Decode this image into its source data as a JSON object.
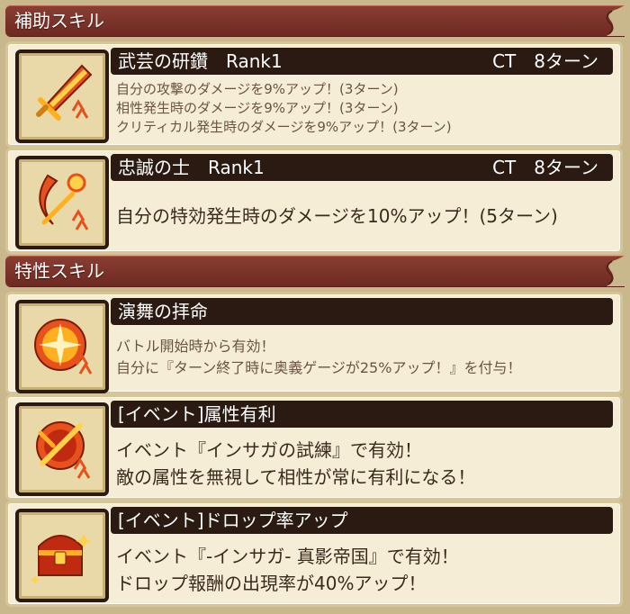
{
  "sections": [
    {
      "title": "補助スキル",
      "skills": [
        {
          "icon": "flaming-sword-icon",
          "name": "武芸の研鑽　Rank1",
          "ct": "CT　8ターン",
          "desc": [
            "自分の攻撃のダメージを9%アップ！(3ターン)",
            "相性発生時のダメージを9%アップ！(3ターン)",
            "クリティカル発生時のダメージを9%アップ！(3ターン)"
          ]
        },
        {
          "icon": "crescent-slash-icon",
          "name": "忠誠の士　Rank1",
          "ct": "CT　8ターン",
          "desc": [
            "自分の特効発生時のダメージを10%アップ！(5ターン)"
          ]
        }
      ]
    },
    {
      "title": "特性スキル",
      "skills": [
        {
          "icon": "burst-emblem-icon",
          "name": "演舞の拝命",
          "desc": [
            "バトル開始時から有効！",
            "自分に『ターン終了時に奥義ゲージが25%アップ！』を付与！"
          ]
        },
        {
          "icon": "crossed-sword-emblem-icon",
          "name": "[イベント]属性有利",
          "desc": [
            "イベント『インサガの試練』で有効！",
            "敵の属性を無視して相性が常に有利になる！"
          ]
        },
        {
          "icon": "treasure-chest-icon",
          "name": "[イベント]ドロップ率アップ",
          "desc": [
            "イベント『-インサガ- 真影帝国』で有効！",
            "ドロップ報酬の出現率が40%アップ！"
          ]
        }
      ]
    }
  ]
}
